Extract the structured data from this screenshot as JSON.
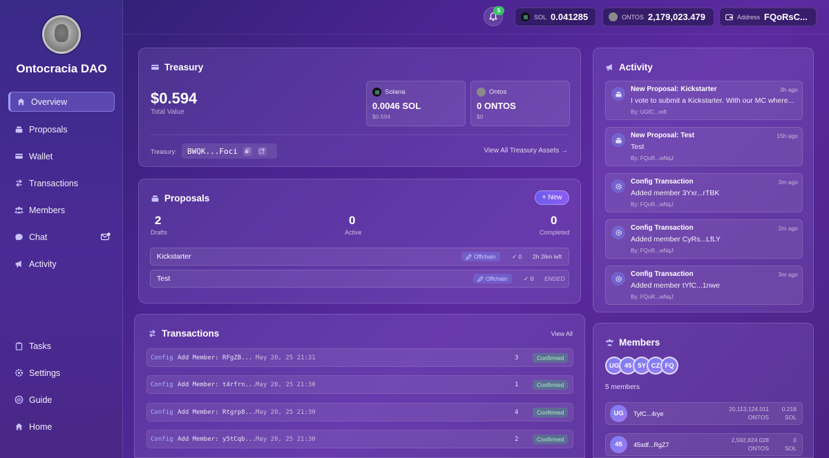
{
  "dao": {
    "name": "Ontocracia DAO"
  },
  "sidebar": {
    "items": [
      {
        "label": "Overview",
        "icon": "home-icon"
      },
      {
        "label": "Proposals",
        "icon": "stack-icon"
      },
      {
        "label": "Wallet",
        "icon": "wallet-icon"
      },
      {
        "label": "Transactions",
        "icon": "arrows-icon"
      },
      {
        "label": "Members",
        "icon": "users-icon"
      },
      {
        "label": "Chat",
        "icon": "chat-icon"
      },
      {
        "label": "Activity",
        "icon": "megaphone-icon"
      }
    ],
    "bottom_items": [
      {
        "label": "Tasks",
        "icon": "clipboard-icon"
      },
      {
        "label": "Settings",
        "icon": "gear-icon"
      },
      {
        "label": "Guide",
        "icon": "book-icon"
      },
      {
        "label": "Home",
        "icon": "home-icon"
      }
    ]
  },
  "topbar": {
    "notification_count": "5",
    "sol_label": "SOL",
    "sol_value": "0.041285",
    "ontos_label": "ONTOS",
    "ontos_value": "2,179,023.479",
    "address_label": "Address",
    "address_value": "FQoRsC..."
  },
  "treasury": {
    "title": "Treasury",
    "total": "$0.594",
    "total_label": "Total Value",
    "assets": [
      {
        "name": "Solana",
        "amount": "0.0046 SOL",
        "usd": "$0.594"
      },
      {
        "name": "Ontos",
        "amount": "0 ONTOS",
        "usd": "$0"
      }
    ],
    "address_label": "Treasury:",
    "address": "BWQK...Foci",
    "view_all": "View All Treasury Assets →"
  },
  "proposals": {
    "title": "Proposals",
    "new_label": "New",
    "stats": [
      {
        "value": "2",
        "label": "Drafts"
      },
      {
        "value": "0",
        "label": "Active"
      },
      {
        "value": "0",
        "label": "Completed"
      }
    ],
    "rows": [
      {
        "name": "Kickstarter",
        "tag": "Offchain",
        "votes": "0",
        "status": "2h 26m left"
      },
      {
        "name": "Test",
        "tag": "Offchain",
        "votes": "0",
        "status": "ENDED"
      }
    ]
  },
  "transactions": {
    "title": "Transactions",
    "view_all": "View All",
    "rows": [
      {
        "type": "Config",
        "desc": "Add Member: RFgZB...",
        "date": "May 20, 25 21:31",
        "n": "3",
        "status": "Confirmed"
      },
      {
        "type": "Config",
        "desc": "Add Member: t4rfrn...",
        "date": "May 20, 25 21:30",
        "n": "1",
        "status": "Confirmed"
      },
      {
        "type": "Config",
        "desc": "Add Member: Rtgrp8...",
        "date": "May 20, 25 21:30",
        "n": "4",
        "status": "Confirmed"
      },
      {
        "type": "Config",
        "desc": "Add Member: y5tCqb...",
        "date": "May 20, 25 21:30",
        "n": "2",
        "status": "Confirmed"
      }
    ]
  },
  "activity": {
    "title": "Activity",
    "items": [
      {
        "title": "New Proposal: Kickstarter",
        "time": "3h ago",
        "body": "I vote to submit a Kickstarter. With our MC where...",
        "by": "By: UGfC...reft",
        "icon": "proposal-icon"
      },
      {
        "title": "New Proposal: Test",
        "time": "15h ago",
        "body": "Test",
        "by": "By: FQoR...wNqJ",
        "icon": "proposal-icon"
      },
      {
        "title": "Config Transaction",
        "time": "3m ago",
        "body": "Added member 3Yxr...rTBK",
        "by": "By: FQoR...wNqJ",
        "icon": "gear-icon"
      },
      {
        "title": "Config Transaction",
        "time": "2m ago",
        "body": "Added member CyRs...LfLY",
        "by": "By: FQoR...wNqJ",
        "icon": "gear-icon"
      },
      {
        "title": "Config Transaction",
        "time": "3m ago",
        "body": "Added member tYfC...1nwe",
        "by": "By: FQoR...wNqJ",
        "icon": "gear-icon"
      }
    ]
  },
  "members": {
    "title": "Members",
    "avatars": [
      "UG",
      "45",
      "5Y",
      "CZ",
      "FQ"
    ],
    "count_label": "5 members",
    "rows": [
      {
        "initials": "UG",
        "name": "TyfC...4rye",
        "ontos": "20,113,124.011",
        "ontos_unit": "ONTOS",
        "sol": "0.218",
        "sol_unit": "SOL"
      },
      {
        "initials": "45",
        "name": "45sdf...RgZ7",
        "ontos": "2,592,824.028",
        "ontos_unit": "ONTOS",
        "sol": "0",
        "sol_unit": "SOL"
      }
    ]
  },
  "colors": {
    "accent": "#7c6cf2",
    "confirmed": "#a8f0c2",
    "badge": "#3fc06a"
  }
}
